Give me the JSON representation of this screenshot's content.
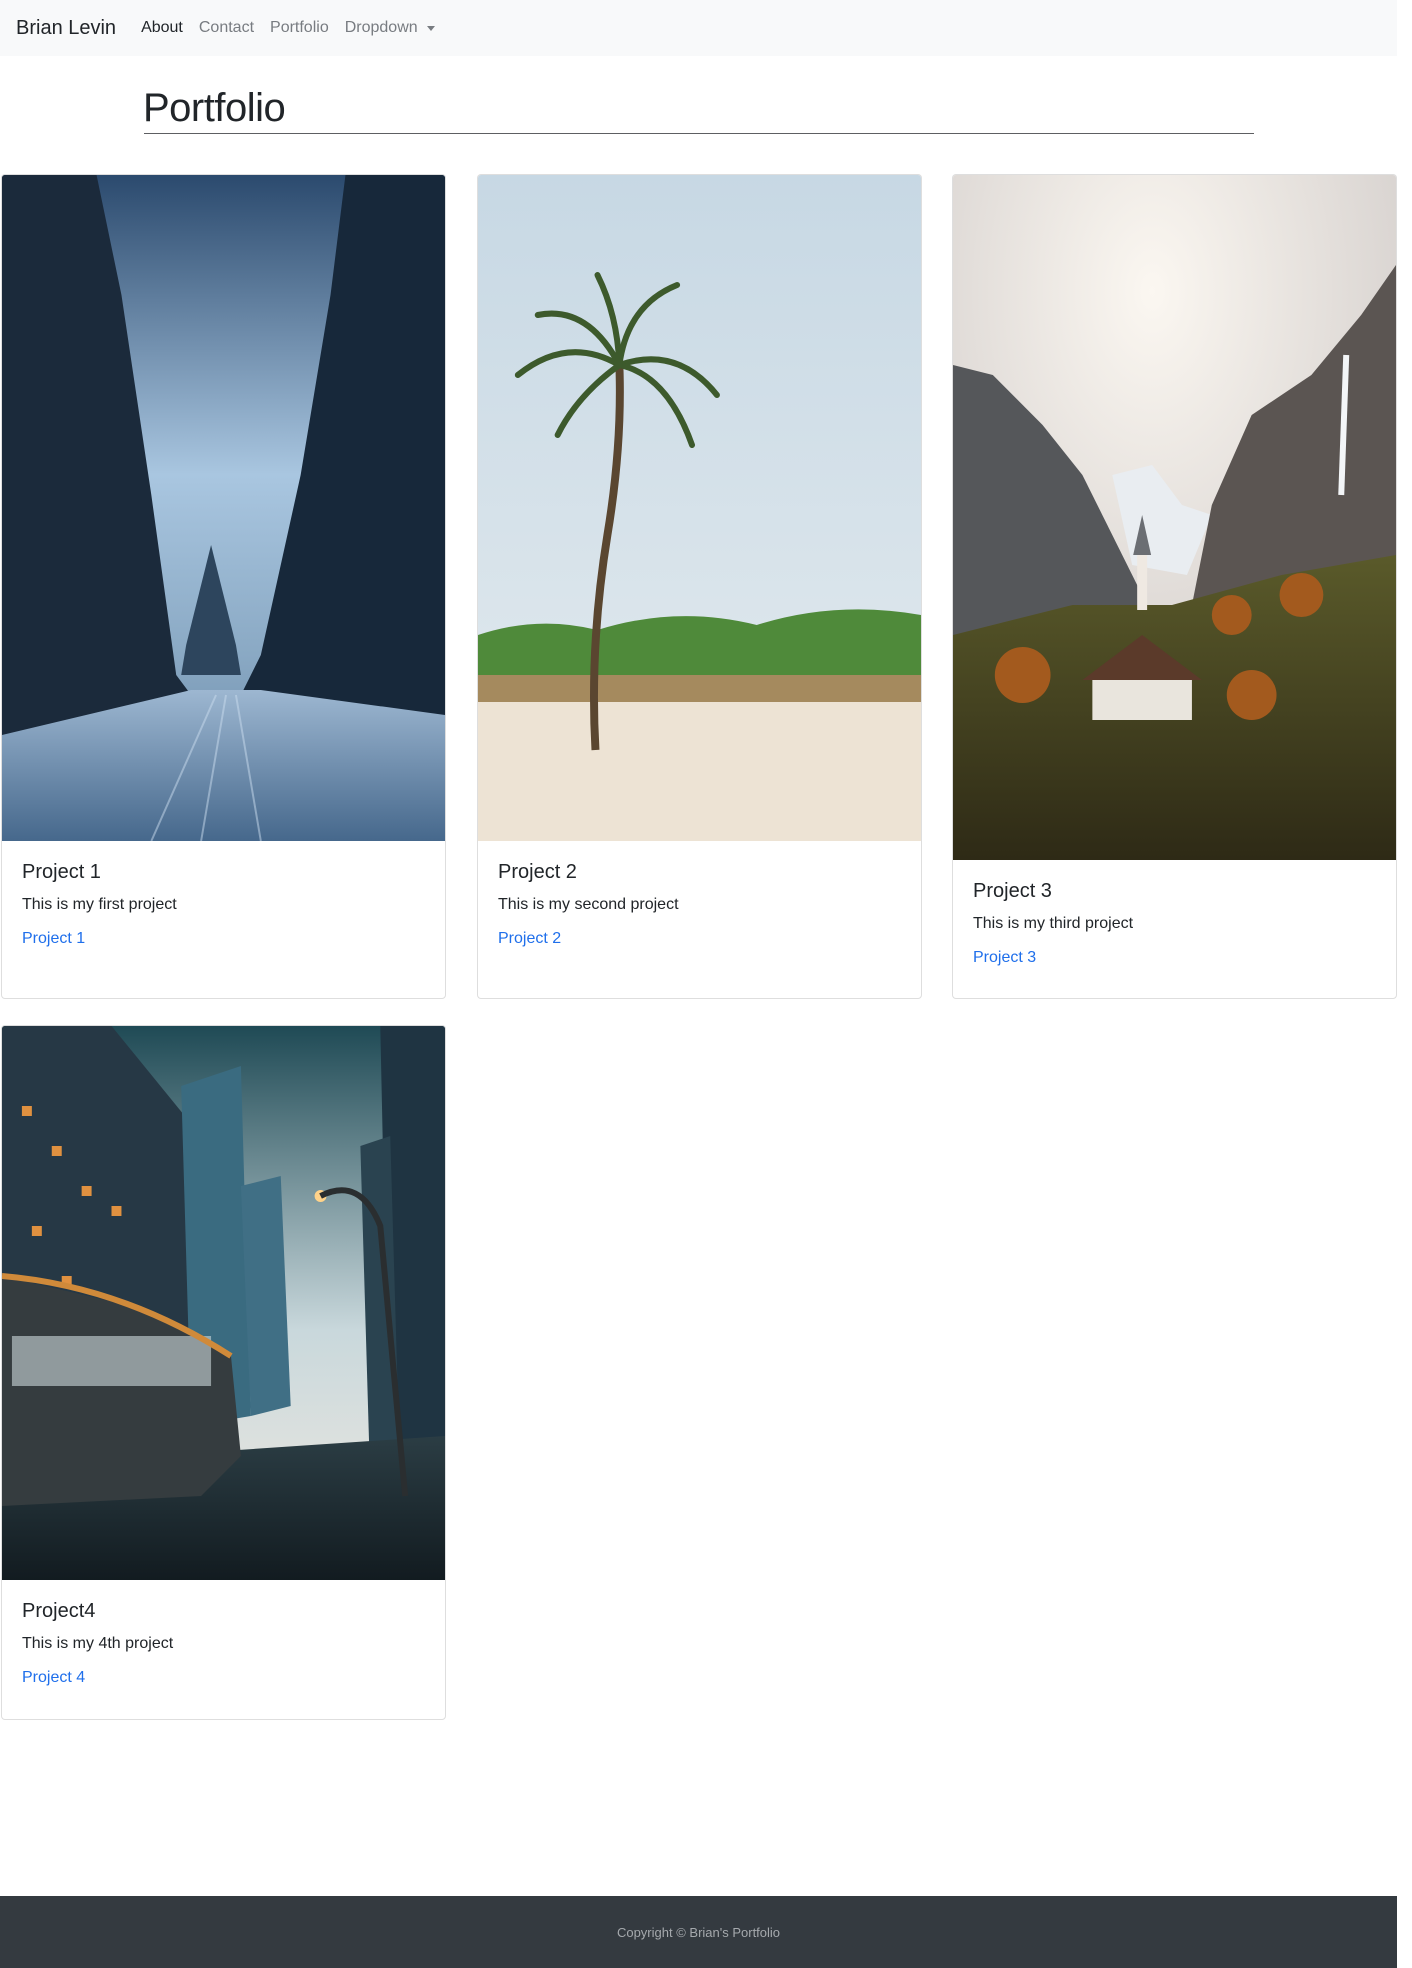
{
  "navbar": {
    "brand": "Brian Levin",
    "links": [
      {
        "label": "About"
      },
      {
        "label": "Contact"
      },
      {
        "label": "Portfolio"
      },
      {
        "label": "Dropdown"
      }
    ]
  },
  "page": {
    "title": "Portfolio"
  },
  "cards": [
    {
      "title": "Project 1",
      "text": "This is my first project",
      "link": "Project 1",
      "image_icon": "snowy-forest-road-photo"
    },
    {
      "title": "Project 2",
      "text": "This is my second project",
      "link": "Project 2",
      "image_icon": "palm-tree-beach-photo"
    },
    {
      "title": "Project 3",
      "text": "This is my third project",
      "link": "Project 3",
      "image_icon": "alpine-valley-village-photo"
    },
    {
      "title": "Project4",
      "text": "This is my 4th project",
      "link": "Project 4",
      "image_icon": "city-street-metro-bus-photo"
    }
  ],
  "footer": {
    "text": "Copyright © Brian's Portfolio"
  },
  "colors": {
    "navbar_bg": "#f8f9fa",
    "link": "#1f6feb",
    "footer_bg": "#343a40"
  }
}
